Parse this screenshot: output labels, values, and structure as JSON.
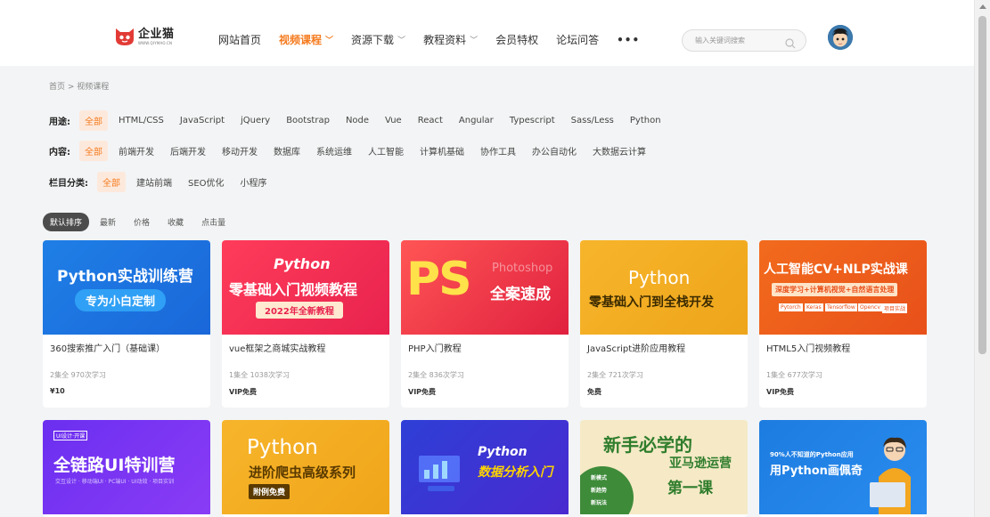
{
  "header": {
    "logo_name": "企业猫",
    "logo_url": "WWW.QIYMAO.CN",
    "nav": [
      {
        "label": "网站首页",
        "active": false,
        "dropdown": false
      },
      {
        "label": "视频课程",
        "active": true,
        "dropdown": true
      },
      {
        "label": "资源下载",
        "active": false,
        "dropdown": true
      },
      {
        "label": "教程资料",
        "active": false,
        "dropdown": true
      },
      {
        "label": "会员特权",
        "active": false,
        "dropdown": false
      },
      {
        "label": "论坛问答",
        "active": false,
        "dropdown": false
      }
    ],
    "more": "•••",
    "search_placeholder": "输入关键词搜索"
  },
  "breadcrumb": "首页 > 视频课程",
  "filters": [
    {
      "label": "用途:",
      "options": [
        "全部",
        "HTML/CSS",
        "JavaScript",
        "jQuery",
        "Bootstrap",
        "Node",
        "Vue",
        "React",
        "Angular",
        "Typescript",
        "Sass/Less",
        "Python"
      ]
    },
    {
      "label": "内容:",
      "options": [
        "全部",
        "前端开发",
        "后端开发",
        "移动开发",
        "数据库",
        "系统运维",
        "人工智能",
        "计算机基础",
        "协作工具",
        "办公自动化",
        "大数据云计算"
      ]
    },
    {
      "label": "栏目分类:",
      "options": [
        "全部",
        "建站前端",
        "SEO优化",
        "小程序"
      ]
    }
  ],
  "sort_tabs": [
    "默认排序",
    "最新",
    "价格",
    "收藏",
    "点击量"
  ],
  "cards_row1": [
    {
      "title": "360搜索推广入门（基础课）",
      "stats": "2集全 970次学习",
      "price": "¥10",
      "cover": {
        "line1": "Python实战训练营",
        "line2": "专为小白定制"
      }
    },
    {
      "title": "vue框架之商城实战教程",
      "stats": "1集全 1038次学习",
      "price": "VIP免费",
      "cover": {
        "line1": "Python",
        "line2": "零基础入门视频教程",
        "line3": "2022年全新教程"
      }
    },
    {
      "title": "PHP入门教程",
      "stats": "2集全 836次学习",
      "price": "VIP免费",
      "cover": {
        "line1": "PS",
        "line2": "全案速成",
        "line3": "Photoshop"
      }
    },
    {
      "title": "JavaScript进阶应用教程",
      "stats": "2集全 721次学习",
      "price": "免费",
      "cover": {
        "line1": "Python",
        "line2": "零基础入门到全栈开发"
      }
    },
    {
      "title": "HTML5入门视频教程",
      "stats": "1集全 677次学习",
      "price": "VIP免费",
      "cover": {
        "line1": "人工智能CV+NLP实战课",
        "line2": "深度学习+计算机视觉+自然语言处理",
        "tags": [
          "Pytorch",
          "Keras",
          "Tensorflow",
          "Opencv",
          "项目实战"
        ]
      }
    }
  ],
  "cards_row2": [
    {
      "cover": {
        "line1": "全链路UI特训营",
        "line2": "交互设计 · 移动端UI · PC端UI · UI动效 · 项目实训",
        "tag": "UI设计·开课"
      }
    },
    {
      "cover": {
        "line1": "Python",
        "line2": "进阶爬虫高级系列",
        "line3": "附例免费"
      }
    },
    {
      "cover": {
        "line1": "Python",
        "line2": "数据分析入门"
      }
    },
    {
      "cover": {
        "line1": "新手必学的",
        "line2": "亚马逊运营",
        "line3": "第一课",
        "bullets": [
          "新模式",
          "新趋势",
          "新玩法"
        ]
      }
    },
    {
      "cover": {
        "line1": "90%人不知道的Python应用",
        "line2": "用Python画佩奇"
      }
    }
  ],
  "colors": {
    "accent": "#f57b1f",
    "active_bg": "#fde9dc"
  }
}
